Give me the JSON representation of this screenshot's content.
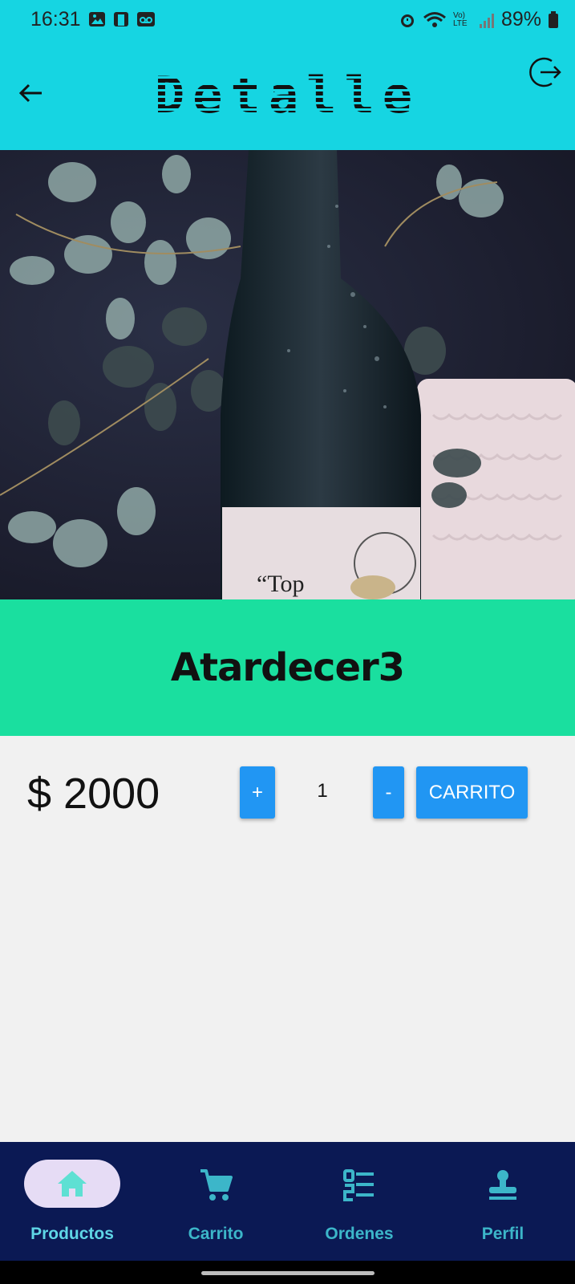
{
  "status_bar": {
    "time": "16:31",
    "battery": "89%",
    "network": "Vo) LTE"
  },
  "header": {
    "title": "Detalle"
  },
  "product": {
    "name": "Atardecer3",
    "price": "$ 2000",
    "quantity": "1"
  },
  "actions": {
    "plus": "+",
    "minus": "-",
    "cart": "CARRITO"
  },
  "nav": {
    "items": [
      {
        "label": "Productos",
        "icon": "home-icon",
        "active": true
      },
      {
        "label": "Carrito",
        "icon": "cart-icon",
        "active": false
      },
      {
        "label": "Ordenes",
        "icon": "orders-icon",
        "active": false
      },
      {
        "label": "Perfil",
        "icon": "profile-icon",
        "active": false
      }
    ]
  },
  "colors": {
    "appbar": "#16d5e2",
    "namebar": "#1adf9f",
    "button": "#2196f3",
    "nav_bg": "#0b1954",
    "nav_label": "#3cb6c9",
    "active_pill": "#e6dcf5"
  }
}
